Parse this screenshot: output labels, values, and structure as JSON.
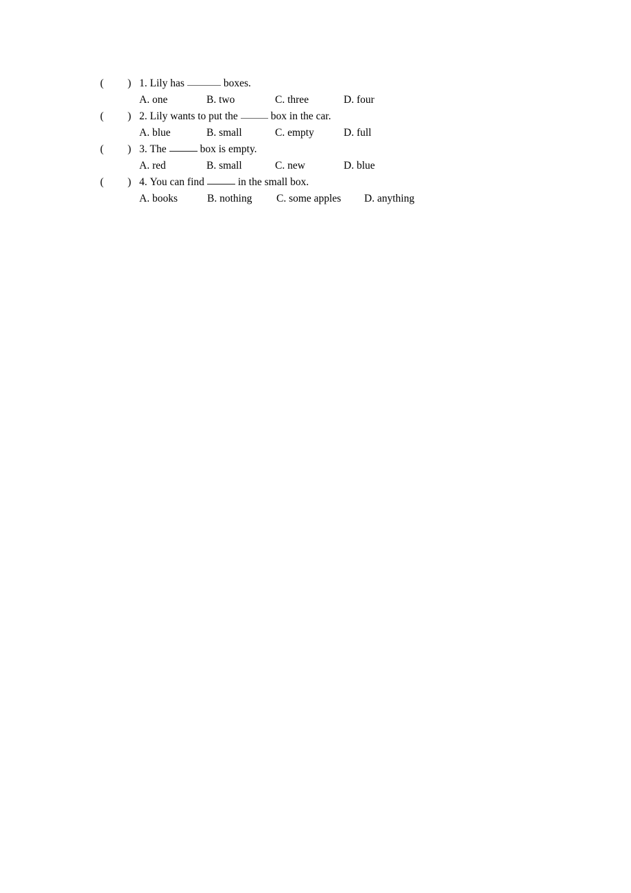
{
  "document": {
    "background_color": "#ffffff",
    "text_color": "#000000"
  },
  "exercise": {
    "bracket_open": "(",
    "bracket_close": ")",
    "questions": [
      {
        "number": "1.",
        "stem_before": "Lily has",
        "blank": "______",
        "stem_after": "boxes.",
        "options": [
          {
            "label": "A.",
            "text": "one"
          },
          {
            "label": "B.",
            "text": "two"
          },
          {
            "label": "C.",
            "text": "three"
          },
          {
            "label": "D.",
            "text": "four"
          }
        ]
      },
      {
        "number": "2.",
        "stem_before": "Lily wants to put the",
        "blank": "_____",
        "stem_after": "box in the car.",
        "options": [
          {
            "label": "A.",
            "text": "blue"
          },
          {
            "label": "B.",
            "text": "small"
          },
          {
            "label": "C.",
            "text": "empty"
          },
          {
            "label": "D.",
            "text": "full"
          }
        ]
      },
      {
        "number": "3.",
        "stem_before": "The",
        "blank": "_____",
        "stem_after": "box is empty.",
        "options": [
          {
            "label": "A.",
            "text": "red"
          },
          {
            "label": "B.",
            "text": "small"
          },
          {
            "label": "C.",
            "text": "new"
          },
          {
            "label": "D.",
            "text": "blue"
          }
        ]
      },
      {
        "number": "4.",
        "stem_before": "You can find",
        "blank": "_____",
        "stem_after": "in the small box.",
        "options": [
          {
            "label": "A.",
            "text": "books"
          },
          {
            "label": "B.",
            "text": "nothing"
          },
          {
            "label": "C.",
            "text": "some apples"
          },
          {
            "label": "D.",
            "text": "anything"
          }
        ]
      }
    ]
  }
}
